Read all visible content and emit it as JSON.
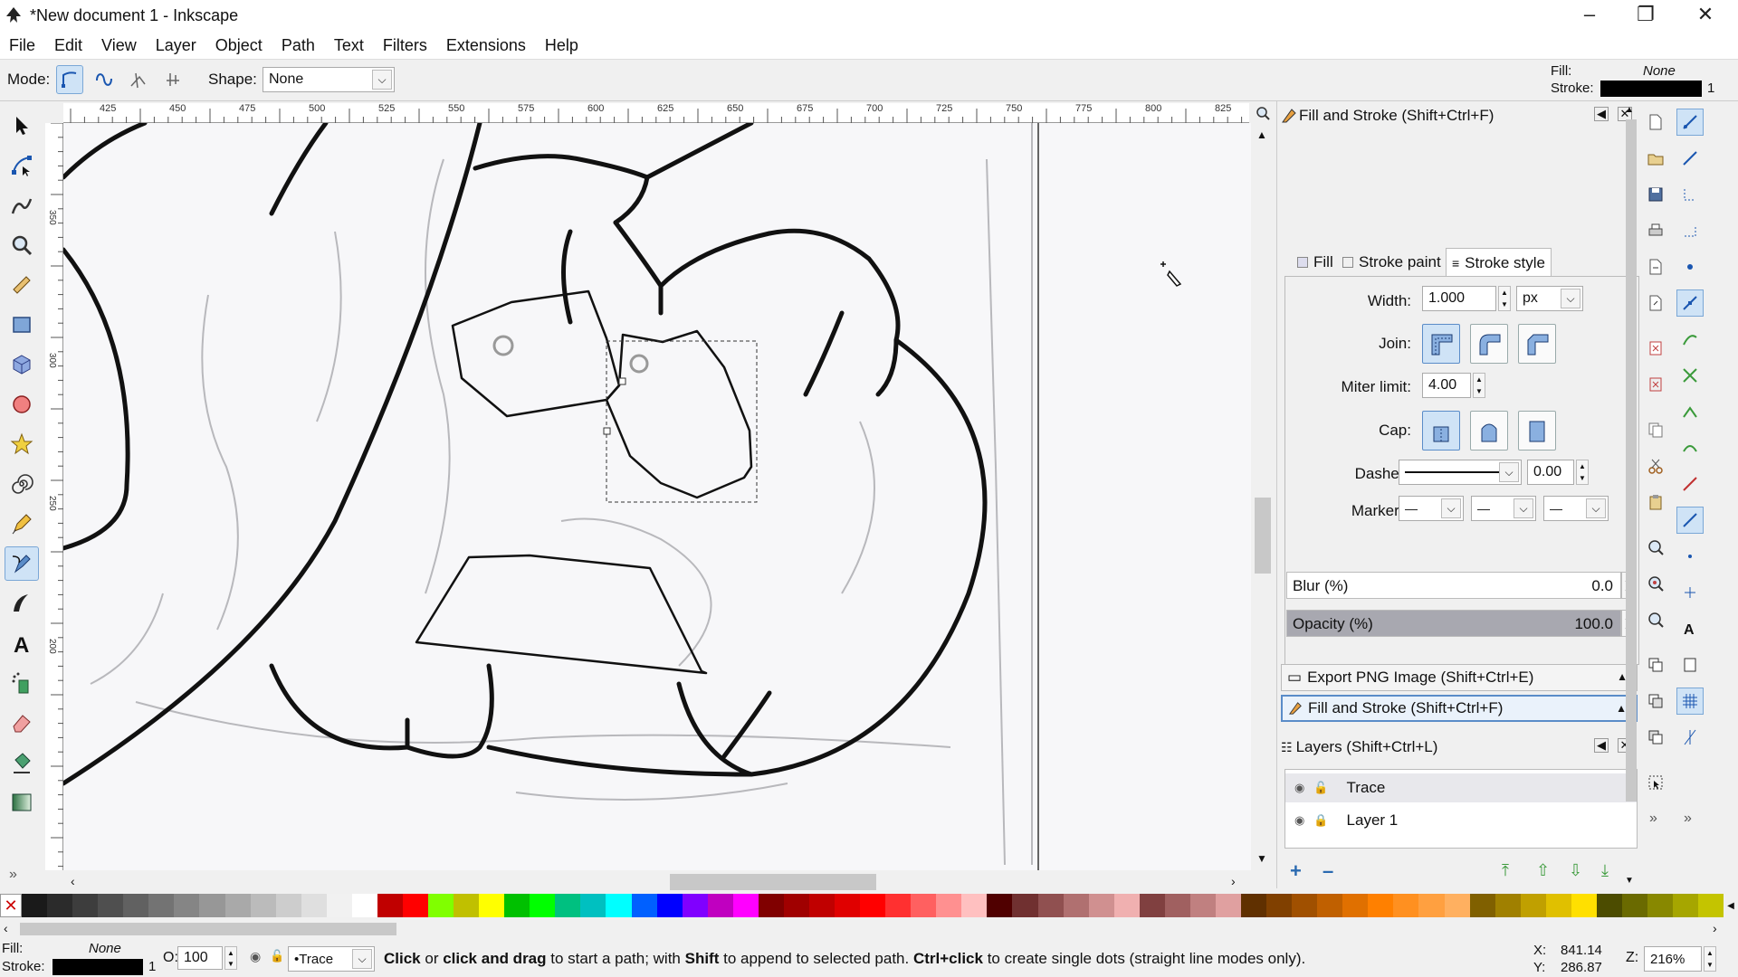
{
  "window": {
    "title": "*New document 1 - Inkscape"
  },
  "menu": [
    "File",
    "Edit",
    "View",
    "Layer",
    "Object",
    "Path",
    "Text",
    "Filters",
    "Extensions",
    "Help"
  ],
  "controls": {
    "mode_label": "Mode:",
    "shape_label": "Shape:",
    "shape_value": "None"
  },
  "style_indicator": {
    "fill_label": "Fill:",
    "fill_value": "None",
    "stroke_label": "Stroke:",
    "stroke_width": "1",
    "stroke_color": "#000000"
  },
  "ruler_labels": [
    "425",
    "450",
    "475",
    "500",
    "525",
    "550",
    "575",
    "600",
    "625",
    "650",
    "675",
    "700",
    "725",
    "750",
    "775",
    "800",
    "825"
  ],
  "vruler_labels": [
    "350",
    "300",
    "250",
    "200"
  ],
  "fill_stroke": {
    "title": "Fill and Stroke (Shift+Ctrl+F)",
    "tabs": [
      "Fill",
      "Stroke paint",
      "Stroke style"
    ],
    "width_label": "Width:",
    "width_value": "1.000",
    "unit": "px",
    "join_label": "Join:",
    "miter_label": "Miter limit:",
    "miter_value": "4.00",
    "cap_label": "Cap:",
    "dashes_label": "Dashes:",
    "dashes_offset": "0.00",
    "markers_label": "Markers:",
    "blur_label": "Blur (%)",
    "blur_value": "0.0",
    "opacity_label": "Opacity (%)",
    "opacity_value": "100.0",
    "opacity_level": 1.0
  },
  "collapsed_panels": [
    "Export PNG Image (Shift+Ctrl+E)",
    "Fill and Stroke (Shift+Ctrl+F)"
  ],
  "layers": {
    "title": "Layers (Shift+Ctrl+L)",
    "items": [
      "Trace",
      "Layer 1"
    ]
  },
  "palette": [
    "#1a1a1a",
    "#2b2b2b",
    "#3d3d3d",
    "#4f4f4f",
    "#616161",
    "#737373",
    "#858585",
    "#979797",
    "#a9a9a9",
    "#bbbbbb",
    "#cdcdcd",
    "#dfdfdf",
    "#f1f1f1",
    "#ffffff",
    "#c00000",
    "#ff0000",
    "#80ff00",
    "#c0c000",
    "#ffff00",
    "#00c000",
    "#00ff00",
    "#00c080",
    "#00c0c0",
    "#00ffff",
    "#0060ff",
    "#0000ff",
    "#8000ff",
    "#c000c0",
    "#ff00ff",
    "#800000",
    "#a00000",
    "#c00000",
    "#e00000",
    "#ff0000",
    "#ff3030",
    "#ff6060",
    "#ff9090",
    "#ffc0c0",
    "#500000",
    "#703030",
    "#905050",
    "#b07070",
    "#d09090",
    "#f0b0b0",
    "#804040",
    "#a06060",
    "#c08080",
    "#e0a0a0",
    "#603000",
    "#804000",
    "#a05000",
    "#c06000",
    "#e07000",
    "#ff8000",
    "#ff9020",
    "#ffa040",
    "#ffb060",
    "#806000",
    "#a08000",
    "#c0a000",
    "#e0c000",
    "#ffe000",
    "#4c4c00",
    "#6a6a00",
    "#888800",
    "#a6a600",
    "#c4c400"
  ],
  "statusbar": {
    "fill_label": "Fill:",
    "fill_value": "None",
    "stroke_label": "Stroke:",
    "stroke_width": "1",
    "opacity_label": "O:",
    "opacity_value": "100",
    "layer": "•Trace",
    "msg_parts": [
      "Click",
      " or ",
      "click and drag",
      " to start a path; with ",
      "Shift",
      " to append to selected path. ",
      "Ctrl+click",
      " to create single dots (straight line modes only)."
    ],
    "x_label": "X:",
    "x_value": "841.14",
    "y_label": "Y:",
    "y_value": "286.87",
    "zoom_label": "Z:",
    "zoom_value": "216%"
  },
  "colors": {
    "accent": "#cfe3f6",
    "accent_border": "#5a8cc8"
  }
}
